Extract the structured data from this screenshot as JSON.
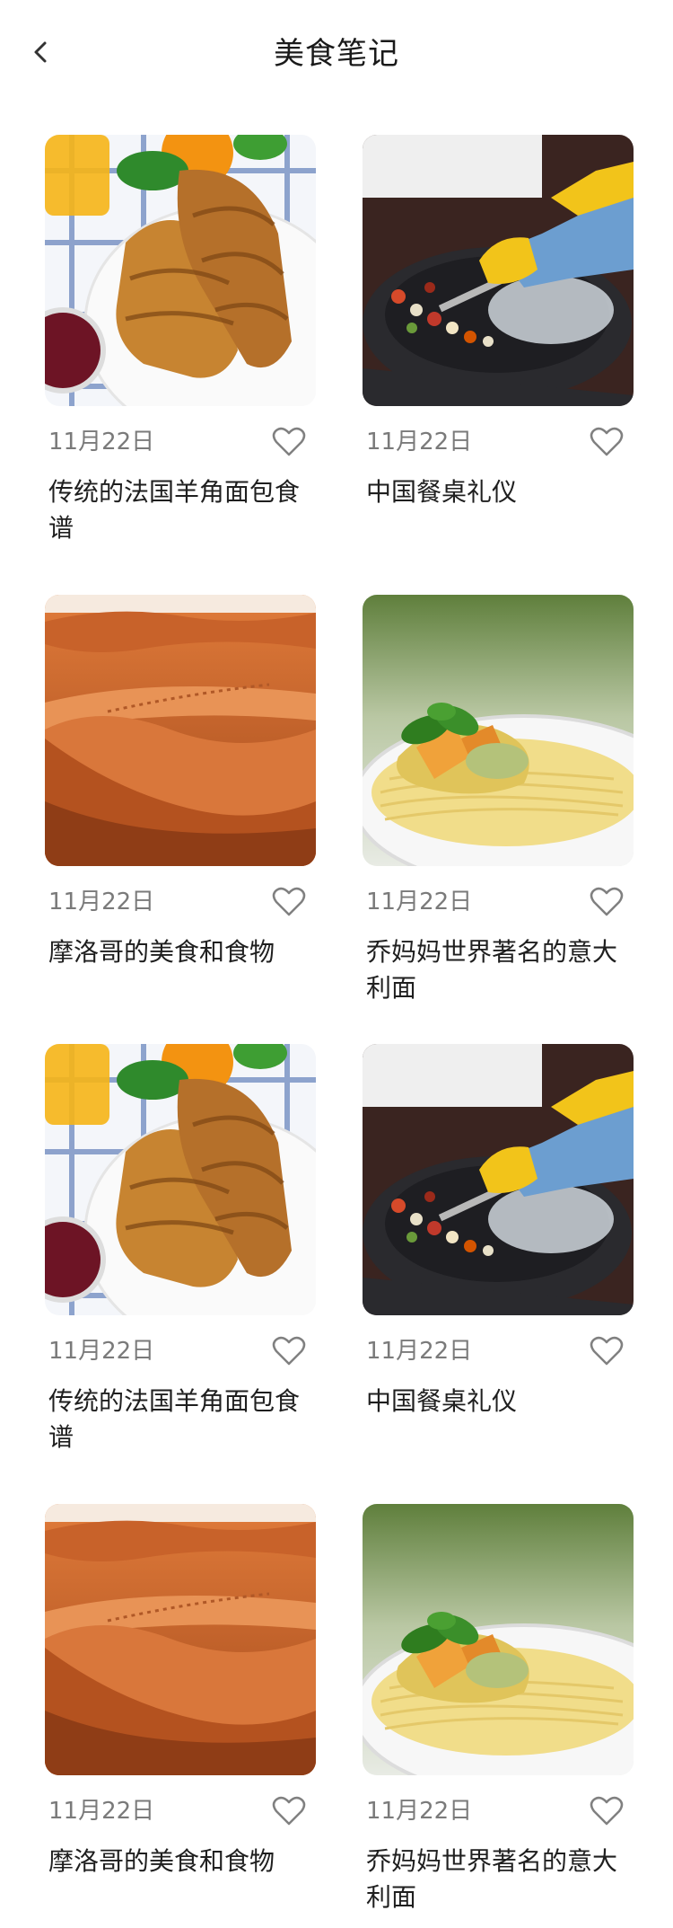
{
  "header": {
    "title": "美食笔记"
  },
  "cards": [
    {
      "date": "11月22日",
      "title": "传统的法国羊角面包食谱",
      "image": "croissant"
    },
    {
      "date": "11月22日",
      "title": "中国餐桌礼仪",
      "image": "wok"
    },
    {
      "date": "11月22日",
      "title": "摩洛哥的美食和食物",
      "image": "desert"
    },
    {
      "date": "11月22日",
      "title": "乔妈妈世界著名的意大利面",
      "image": "pasta"
    },
    {
      "date": "11月22日",
      "title": "传统的法国羊角面包食谱",
      "image": "croissant"
    },
    {
      "date": "11月22日",
      "title": "中国餐桌礼仪",
      "image": "wok"
    },
    {
      "date": "11月22日",
      "title": "摩洛哥的美食和食物",
      "image": "desert"
    },
    {
      "date": "11月22日",
      "title": "乔妈妈世界著名的意大利面",
      "image": "pasta"
    }
  ],
  "icons": {
    "back": "chevron-left-icon",
    "favorite": "heart-outline-icon"
  },
  "colors": {
    "title": "#1a1a1a",
    "date": "#7a7a7a",
    "icon": "#808080"
  }
}
